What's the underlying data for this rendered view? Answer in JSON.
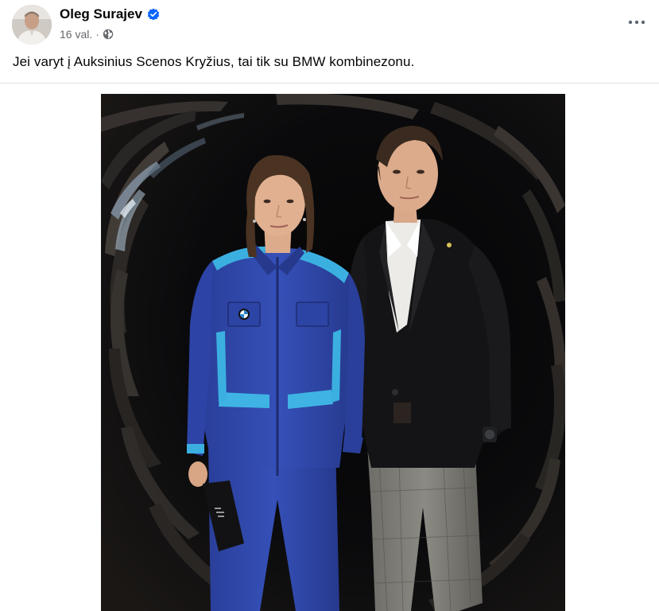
{
  "post": {
    "author": "Oleg Surajev",
    "verified": true,
    "time": "16 val.",
    "separator": "·",
    "audience_icon": "globe-icon",
    "text": "Jei varyt į Auksinius Scenos Kryžius, tai tik su BMW kombinezonu.",
    "more_icon": "more-horizontal-icon"
  },
  "colors": {
    "text_primary": "#050505",
    "text_secondary": "#65676b",
    "verified_blue": "#0866ff",
    "divider": "#dfe1e5"
  }
}
